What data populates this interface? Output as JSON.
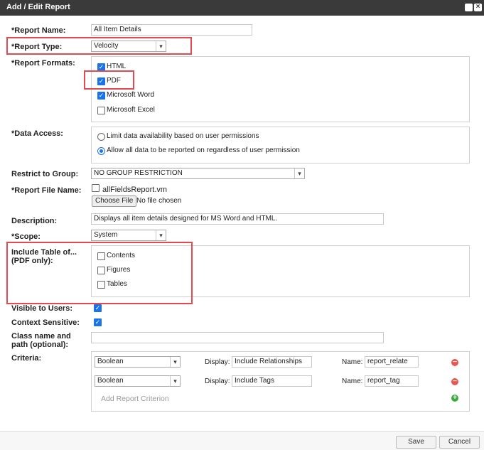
{
  "title": "Add / Edit Report",
  "fields": {
    "report_name": {
      "label": "*Report Name:",
      "value": "All Item Details"
    },
    "report_type": {
      "label": "*Report Type:",
      "value": "Velocity"
    },
    "report_formats": {
      "label": "*Report Formats:",
      "options": [
        {
          "label": "HTML",
          "checked": true
        },
        {
          "label": "PDF",
          "checked": true
        },
        {
          "label": "Microsoft Word",
          "checked": true
        },
        {
          "label": "Microsoft Excel",
          "checked": false
        }
      ]
    },
    "data_access": {
      "label": "*Data Access:",
      "options": [
        {
          "label": "Limit data availability based on user permissions",
          "selected": false
        },
        {
          "label": "Allow all data to be reported on regardless of user permission",
          "selected": true
        }
      ]
    },
    "restrict_group": {
      "label": "Restrict to Group:",
      "value": "NO GROUP RESTRICTION"
    },
    "report_file_name": {
      "label": "*Report File Name:",
      "file": "allFieldsReport.vm",
      "button": "Choose File",
      "status": "No file chosen"
    },
    "description": {
      "label": "Description:",
      "value": "Displays all item details designed for MS Word and HTML."
    },
    "scope": {
      "label": "*Scope:",
      "value": "System"
    },
    "include_table": {
      "label1": "Include Table of...",
      "label2": "(PDF only):",
      "options": [
        {
          "label": "Contents",
          "checked": false
        },
        {
          "label": "Figures",
          "checked": false
        },
        {
          "label": "Tables",
          "checked": false
        }
      ]
    },
    "visible_to_users": {
      "label": "Visible to Users:",
      "checked": true
    },
    "context_sensitive": {
      "label": "Context Sensitive:",
      "checked": true
    },
    "class_name": {
      "label1": "Class name and",
      "label2": "path (optional):",
      "value": ""
    },
    "criteria": {
      "label": "Criteria:",
      "display_label": "Display:",
      "name_label": "Name:",
      "rows": [
        {
          "type": "Boolean",
          "display": "Include Relationships",
          "name": "report_relate"
        },
        {
          "type": "Boolean",
          "display": "Include Tags",
          "name": "report_tag"
        }
      ],
      "add_label": "Add Report Criterion"
    }
  },
  "footer": {
    "save": "Save",
    "cancel": "Cancel"
  },
  "colors": {
    "highlight": "#e04a50",
    "check": "#1a73e8",
    "remove": "#e8574f",
    "add": "#3bab3e",
    "titlebar": "#3a3a3a"
  },
  "icons": [
    "restore-icon",
    "close-icon",
    "chevron-down-icon",
    "checkmark-icon",
    "remove-criterion-icon",
    "add-criterion-icon"
  ]
}
